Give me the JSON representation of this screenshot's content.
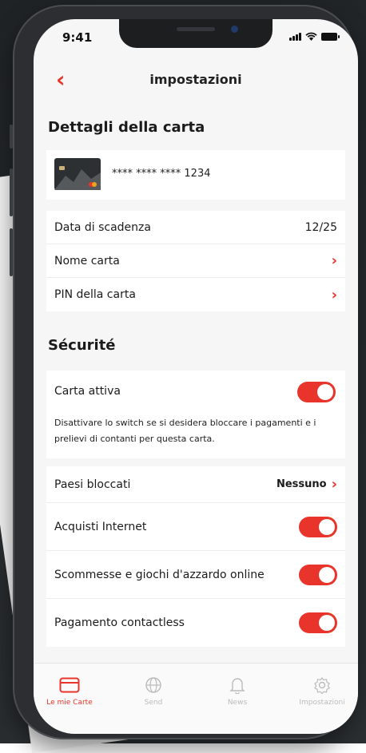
{
  "status_bar": {
    "time": "9:41"
  },
  "nav": {
    "title": "impostazioni"
  },
  "card_details": {
    "section_title": "Dettagli della carta",
    "masked_number": "**** **** **** 1234",
    "expiry_label": "Data di scadenza",
    "expiry_value": "12/25",
    "card_name_label": "Nome carta",
    "pin_label": "PIN della carta"
  },
  "security": {
    "section_title": "Sécurité",
    "card_active_label": "Carta attiva",
    "card_active_on": true,
    "card_active_hint": "Disattivare lo switch se si desidera bloccare i pagamenti e i prelievi di contanti per questa carta.",
    "blocked_countries_label": "Paesi bloccati",
    "blocked_countries_value": "Nessuno",
    "internet_label": "Acquisti Internet",
    "internet_on": true,
    "gambling_label": "Scommesse e giochi d'azzardo online",
    "gambling_on": true,
    "contactless_label": "Pagamento contactless",
    "contactless_on": true
  },
  "tabbar": {
    "tabs": [
      {
        "label": "Le mie Carte",
        "icon": "card-icon",
        "active": true
      },
      {
        "label": "Send",
        "icon": "globe-icon",
        "active": false
      },
      {
        "label": "News",
        "icon": "bell-icon",
        "active": false
      },
      {
        "label": "Impostazioni",
        "icon": "gear-icon",
        "active": false
      }
    ]
  },
  "colors": {
    "accent": "#e8342a",
    "screen_bg": "#f6f6f6",
    "device": "#2c2e31"
  }
}
